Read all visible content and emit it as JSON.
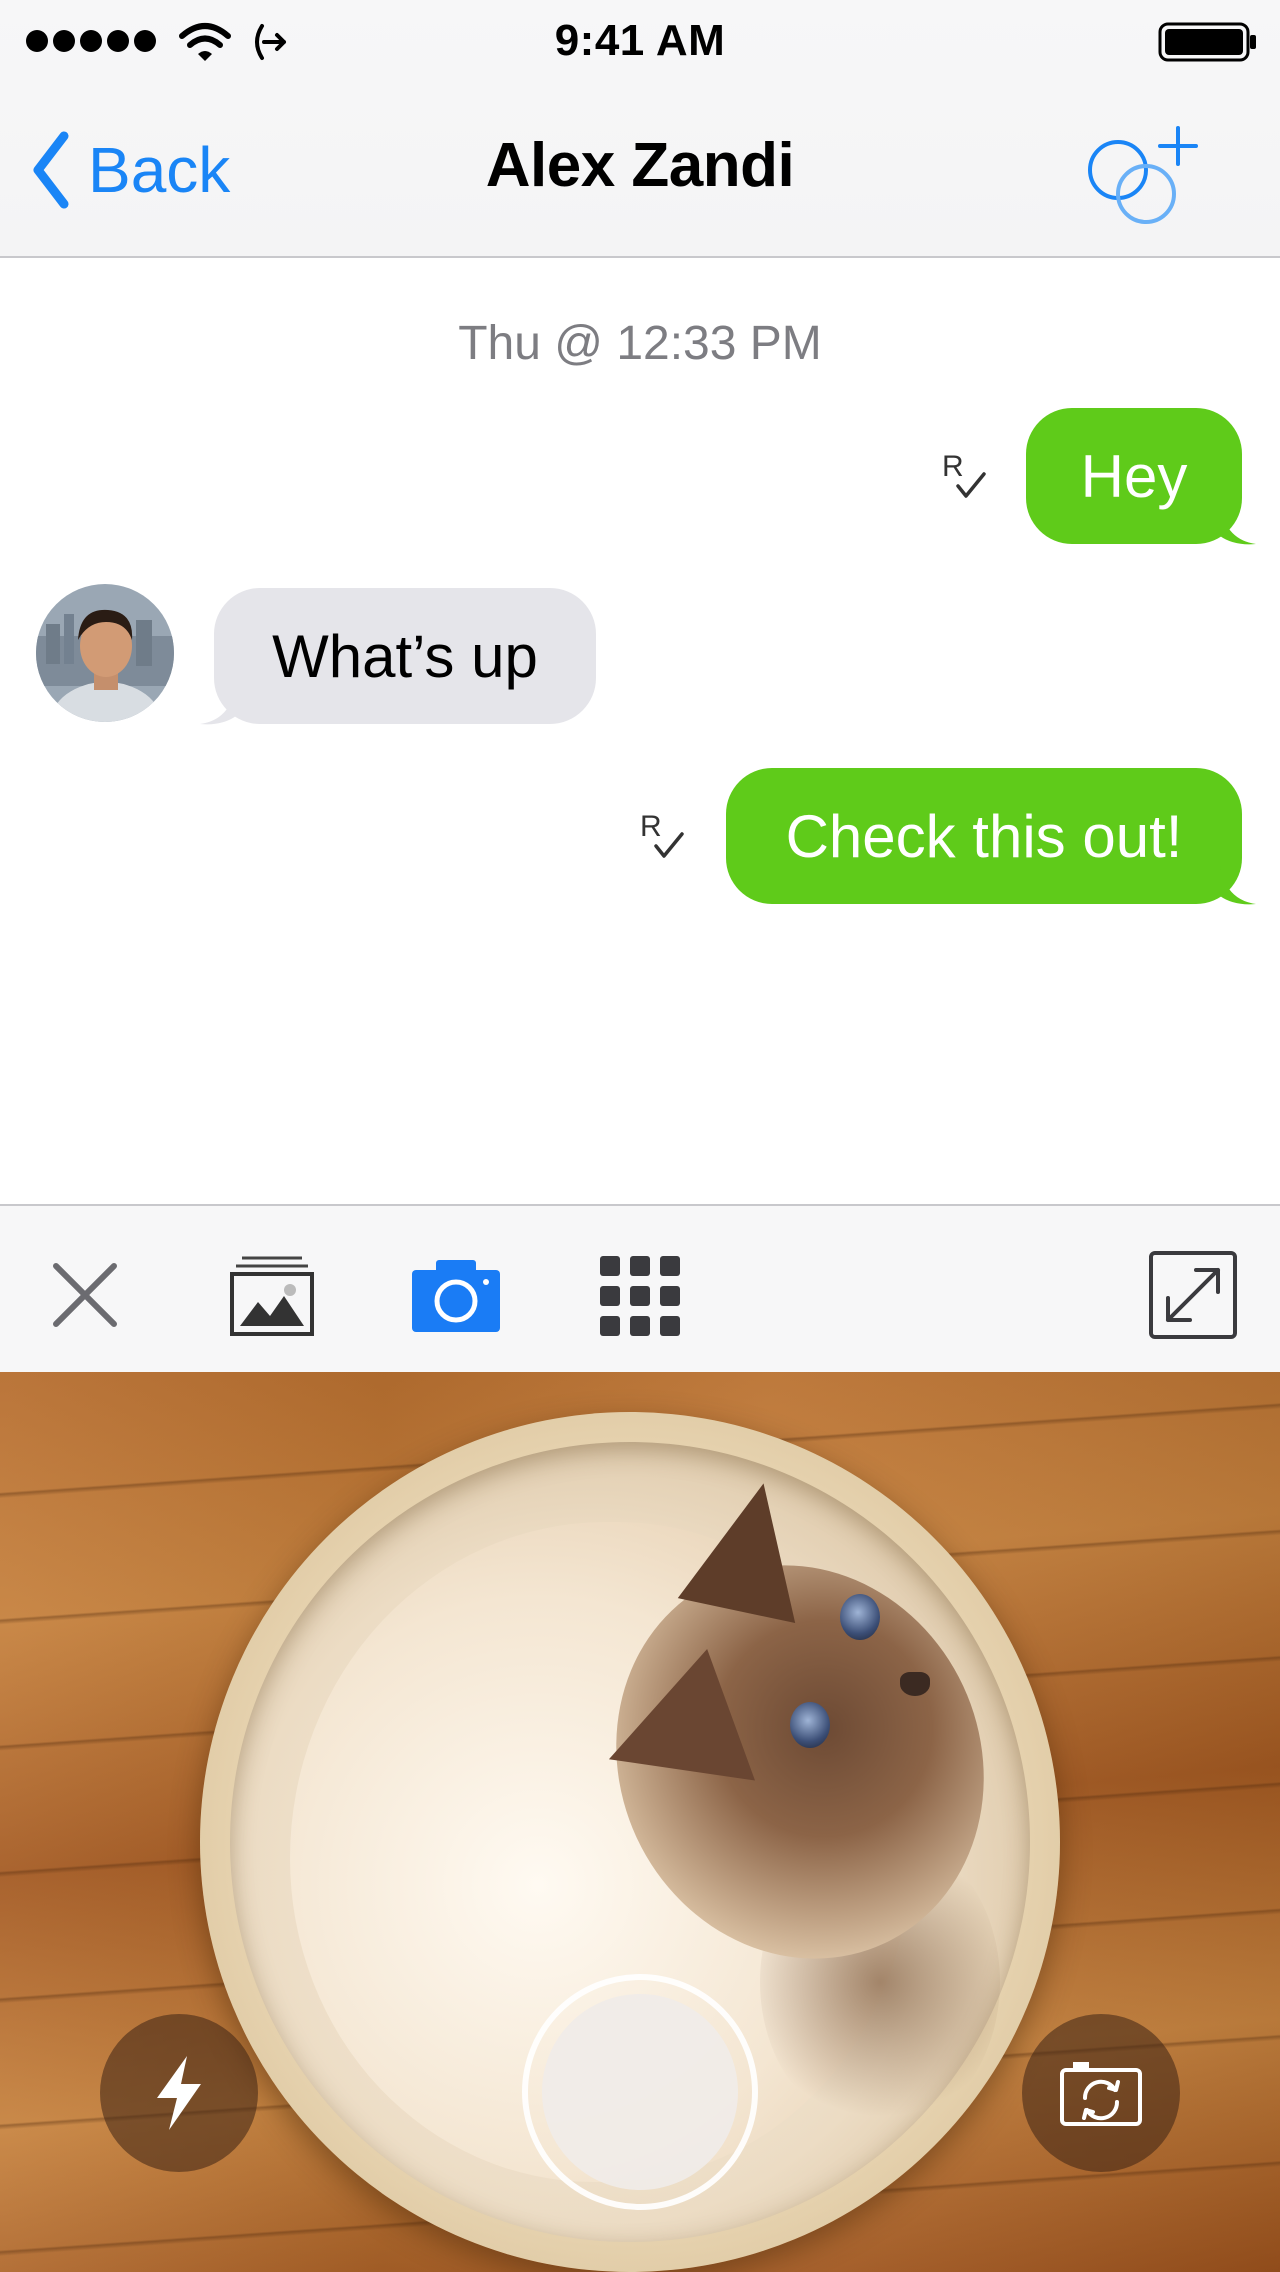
{
  "status_bar": {
    "time": "9:41 AM",
    "signal_icon": "signal-dots-icon",
    "wifi_icon": "wifi-icon",
    "sync_icon": "sync-arrow-icon",
    "battery_icon": "battery-full-icon"
  },
  "nav": {
    "back_label": "Back",
    "title": "Alex Zandi",
    "add_icon": "add-group-icon",
    "accent_color": "#1a85f6"
  },
  "conversation": {
    "timestamp": "Thu @ 12:33 PM",
    "messages": [
      {
        "direction": "outgoing",
        "text": "Hey",
        "receipt_icon": "read-receipt-icon"
      },
      {
        "direction": "incoming",
        "text": "What’s up",
        "avatar_icon": "contact-avatar"
      },
      {
        "direction": "outgoing",
        "text": "Check this out!",
        "receipt_icon": "read-receipt-icon"
      }
    ],
    "outgoing_color": "#5fcb1a",
    "incoming_color": "#e5e5ea"
  },
  "attach_toolbar": {
    "items": [
      {
        "icon": "close-icon",
        "active": false
      },
      {
        "icon": "photo-gallery-icon",
        "active": false
      },
      {
        "icon": "camera-icon",
        "active": true
      },
      {
        "icon": "app-grid-icon",
        "active": false
      },
      {
        "icon": "expand-icon",
        "active": false
      }
    ]
  },
  "camera": {
    "flash_icon": "flash-icon",
    "shutter_icon": "shutter-button",
    "flip_icon": "flip-camera-icon"
  }
}
